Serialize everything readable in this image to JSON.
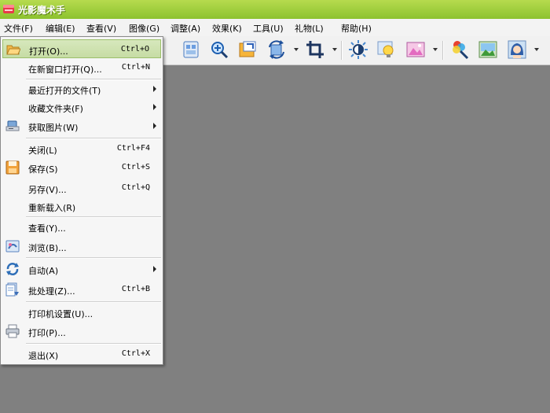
{
  "window": {
    "title": "光影魔术手"
  },
  "menubar": {
    "items": [
      "文件(F)",
      "编辑(E)",
      "查看(V)",
      "图像(G)",
      "调整(A)",
      "效果(K)",
      "工具(U)",
      "礼物(L)",
      "帮助(H)"
    ]
  },
  "toolbar": {
    "buttons": [
      "view-icon",
      "zoom-in-icon",
      "fit-screen-icon",
      "rotate-icon",
      "crop-icon",
      "brightness-icon",
      "light-bulb-icon",
      "landscape-frame-icon",
      "color-picker-icon",
      "picture-icon",
      "portrait-icon"
    ]
  },
  "file_menu": {
    "items": [
      {
        "label": "打开(O)...",
        "shortcut": "Ctrl+O",
        "icon": "folder-open-icon"
      },
      {
        "label": "在新窗口打开(Q)...",
        "shortcut": "Ctrl+N"
      },
      {
        "label": "最近打开的文件(T)",
        "submenu": true
      },
      {
        "label": "收藏文件夹(F)",
        "submenu": true
      },
      {
        "label": "获取图片(W)",
        "submenu": true,
        "icon": "scanner-icon"
      },
      {
        "label": "关闭(L)",
        "shortcut": "Ctrl+F4"
      },
      {
        "label": "保存(S)",
        "shortcut": "Ctrl+S",
        "icon": "floppy-icon"
      },
      {
        "label": "另存(V)...",
        "shortcut": "Ctrl+Q"
      },
      {
        "label": "重新载入(R)"
      },
      {
        "label": "查看(Y)..."
      },
      {
        "label": "浏览(B)...",
        "icon": "browse-icon"
      },
      {
        "label": "自动(A)",
        "submenu": true,
        "icon": "refresh-icon"
      },
      {
        "label": "批处理(Z)...",
        "shortcut": "Ctrl+B",
        "icon": "batch-icon"
      },
      {
        "label": "打印机设置(U)..."
      },
      {
        "label": "打印(P)...",
        "icon": "printer-icon"
      },
      {
        "label": "退出(X)",
        "shortcut": "Ctrl+X"
      }
    ]
  }
}
